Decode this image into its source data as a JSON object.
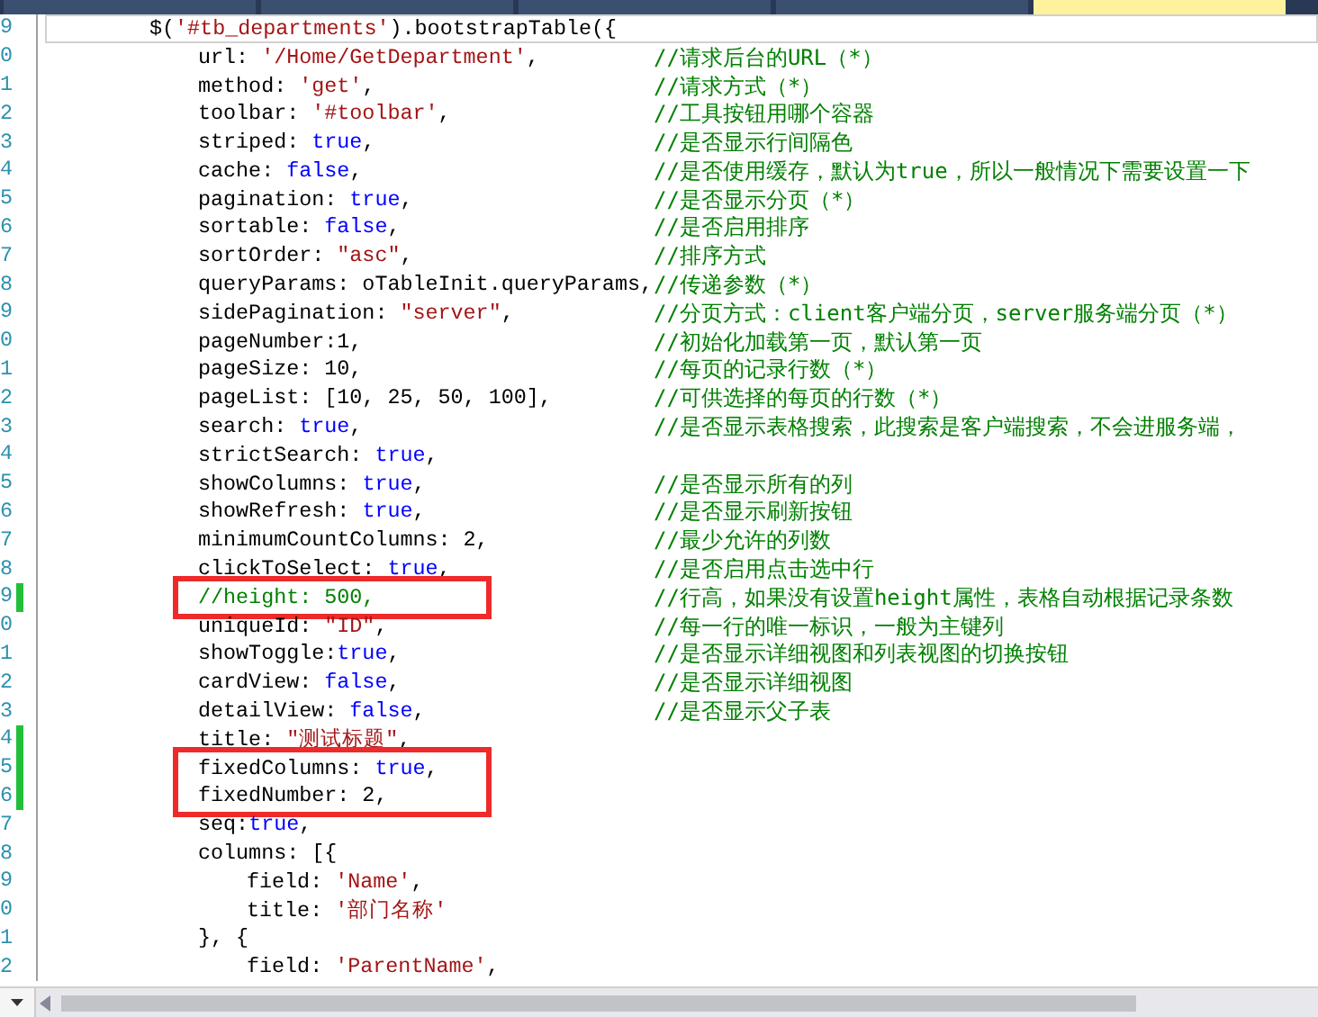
{
  "tabs": [
    {
      "selected": false
    },
    {
      "selected": false
    },
    {
      "selected": false
    },
    {
      "selected": false
    },
    {
      "selected": true
    }
  ],
  "lines": [
    {
      "number": "9",
      "current": true,
      "changed": false,
      "boxed": false,
      "tokens": [
        {
          "kind": "plain",
          "text": "$("
        },
        {
          "kind": "string",
          "text": "'#tb_departments'"
        },
        {
          "kind": "plain",
          "text": ").bootstrapTable({"
        }
      ],
      "children": [
        {
          "number": "0",
          "current": false,
          "changed": false,
          "boxed": false,
          "tokens": [
            {
              "kind": "plain",
              "text": "url: "
            },
            {
              "kind": "string",
              "text": "'/Home/GetDepartment'"
            },
            {
              "kind": "plain",
              "text": ","
            }
          ],
          "comment": "//请求后台的URL（*）"
        },
        {
          "number": "1",
          "current": false,
          "changed": false,
          "boxed": false,
          "tokens": [
            {
              "kind": "plain",
              "text": "method: "
            },
            {
              "kind": "string",
              "text": "'get'"
            },
            {
              "kind": "plain",
              "text": ","
            }
          ],
          "comment": "//请求方式（*）"
        },
        {
          "number": "2",
          "current": false,
          "changed": false,
          "boxed": false,
          "tokens": [
            {
              "kind": "plain",
              "text": "toolbar: "
            },
            {
              "kind": "string",
              "text": "'#toolbar'"
            },
            {
              "kind": "plain",
              "text": ","
            }
          ],
          "comment": "//工具按钮用哪个容器"
        },
        {
          "number": "3",
          "current": false,
          "changed": false,
          "boxed": false,
          "tokens": [
            {
              "kind": "plain",
              "text": "striped: "
            },
            {
              "kind": "keyword",
              "text": "true"
            },
            {
              "kind": "plain",
              "text": ","
            }
          ],
          "comment": "//是否显示行间隔色"
        },
        {
          "number": "4",
          "current": false,
          "changed": false,
          "boxed": false,
          "tokens": [
            {
              "kind": "plain",
              "text": "cache: "
            },
            {
              "kind": "keyword",
              "text": "false"
            },
            {
              "kind": "plain",
              "text": ","
            }
          ],
          "comment": "//是否使用缓存，默认为true，所以一般情况下需要设置一下"
        },
        {
          "number": "5",
          "current": false,
          "changed": false,
          "boxed": false,
          "tokens": [
            {
              "kind": "plain",
              "text": "pagination: "
            },
            {
              "kind": "keyword",
              "text": "true"
            },
            {
              "kind": "plain",
              "text": ","
            }
          ],
          "comment": "//是否显示分页（*）"
        },
        {
          "number": "6",
          "current": false,
          "changed": false,
          "boxed": false,
          "tokens": [
            {
              "kind": "plain",
              "text": "sortable: "
            },
            {
              "kind": "keyword",
              "text": "false"
            },
            {
              "kind": "plain",
              "text": ","
            }
          ],
          "comment": "//是否启用排序"
        },
        {
          "number": "7",
          "current": false,
          "changed": false,
          "boxed": false,
          "tokens": [
            {
              "kind": "plain",
              "text": "sortOrder: "
            },
            {
              "kind": "string",
              "text": "\"asc\""
            },
            {
              "kind": "plain",
              "text": ","
            }
          ],
          "comment": "//排序方式"
        },
        {
          "number": "8",
          "current": false,
          "changed": false,
          "boxed": false,
          "tokens": [
            {
              "kind": "plain",
              "text": "queryParams: oTableInit.queryParams,"
            }
          ],
          "comment": "//传递参数（*）"
        },
        {
          "number": "9",
          "current": false,
          "changed": false,
          "boxed": false,
          "tokens": [
            {
              "kind": "plain",
              "text": "sidePagination: "
            },
            {
              "kind": "string",
              "text": "\"server\""
            },
            {
              "kind": "plain",
              "text": ","
            }
          ],
          "comment": "//分页方式：client客户端分页，server服务端分页（*）"
        },
        {
          "number": "0",
          "current": false,
          "changed": false,
          "boxed": false,
          "tokens": [
            {
              "kind": "plain",
              "text": "pageNumber:1,"
            }
          ],
          "comment": "//初始化加载第一页，默认第一页"
        },
        {
          "number": "1",
          "current": false,
          "changed": false,
          "boxed": false,
          "tokens": [
            {
              "kind": "plain",
              "text": "pageSize: 10,"
            }
          ],
          "comment": "//每页的记录行数（*）"
        },
        {
          "number": "2",
          "current": false,
          "changed": false,
          "boxed": false,
          "tokens": [
            {
              "kind": "plain",
              "text": "pageList: [10, 25, 50, 100],"
            }
          ],
          "comment": "//可供选择的每页的行数（*）"
        },
        {
          "number": "3",
          "current": false,
          "changed": false,
          "boxed": false,
          "tokens": [
            {
              "kind": "plain",
              "text": "search: "
            },
            {
              "kind": "keyword",
              "text": "true"
            },
            {
              "kind": "plain",
              "text": ","
            }
          ],
          "comment": "//是否显示表格搜索，此搜索是客户端搜索，不会进服务端，"
        },
        {
          "number": "4",
          "current": false,
          "changed": false,
          "boxed": false,
          "tokens": [
            {
              "kind": "plain",
              "text": "strictSearch: "
            },
            {
              "kind": "keyword",
              "text": "true"
            },
            {
              "kind": "plain",
              "text": ","
            }
          ]
        },
        {
          "number": "5",
          "current": false,
          "changed": false,
          "boxed": false,
          "tokens": [
            {
              "kind": "plain",
              "text": "showColumns: "
            },
            {
              "kind": "keyword",
              "text": "true"
            },
            {
              "kind": "plain",
              "text": ","
            }
          ],
          "comment": "//是否显示所有的列"
        },
        {
          "number": "6",
          "current": false,
          "changed": false,
          "boxed": false,
          "tokens": [
            {
              "kind": "plain",
              "text": "showRefresh: "
            },
            {
              "kind": "keyword",
              "text": "true"
            },
            {
              "kind": "plain",
              "text": ","
            }
          ],
          "comment": "//是否显示刷新按钮"
        },
        {
          "number": "7",
          "current": false,
          "changed": false,
          "boxed": false,
          "tokens": [
            {
              "kind": "plain",
              "text": "minimumCountColumns: 2,"
            }
          ],
          "comment": "//最少允许的列数"
        },
        {
          "number": "8",
          "current": false,
          "changed": false,
          "boxed": false,
          "tokens": [
            {
              "kind": "plain",
              "text": "clickToSelect: "
            },
            {
              "kind": "keyword",
              "text": "true"
            },
            {
              "kind": "plain",
              "text": ","
            }
          ],
          "comment": "//是否启用点击选中行"
        },
        {
          "number": "9",
          "current": false,
          "changed": true,
          "boxed": true,
          "tokens": [
            {
              "kind": "comment",
              "text": "//height: 500,"
            }
          ],
          "comment": "//行高，如果没有设置height属性，表格自动根据记录条数"
        },
        {
          "number": "0",
          "current": false,
          "changed": false,
          "boxed": false,
          "tokens": [
            {
              "kind": "plain",
              "text": "uniqueId: "
            },
            {
              "kind": "string",
              "text": "\"ID\""
            },
            {
              "kind": "plain",
              "text": ","
            }
          ],
          "comment": "//每一行的唯一标识，一般为主键列"
        },
        {
          "number": "1",
          "current": false,
          "changed": false,
          "boxed": false,
          "tokens": [
            {
              "kind": "plain",
              "text": "showToggle:"
            },
            {
              "kind": "keyword",
              "text": "true"
            },
            {
              "kind": "plain",
              "text": ","
            }
          ],
          "comment": "//是否显示详细视图和列表视图的切换按钮"
        },
        {
          "number": "2",
          "current": false,
          "changed": false,
          "boxed": false,
          "tokens": [
            {
              "kind": "plain",
              "text": "cardView: "
            },
            {
              "kind": "keyword",
              "text": "false"
            },
            {
              "kind": "plain",
              "text": ","
            }
          ],
          "comment": "//是否显示详细视图"
        },
        {
          "number": "3",
          "current": false,
          "changed": false,
          "boxed": false,
          "tokens": [
            {
              "kind": "plain",
              "text": "detailView: "
            },
            {
              "kind": "keyword",
              "text": "false"
            },
            {
              "kind": "plain",
              "text": ","
            }
          ],
          "comment": "//是否显示父子表"
        },
        {
          "number": "4",
          "current": false,
          "changed": true,
          "boxed": false,
          "tokens": [
            {
              "kind": "plain",
              "text": "title: "
            },
            {
              "kind": "string",
              "text": "\"测试标题\""
            },
            {
              "kind": "plain",
              "text": ","
            }
          ]
        },
        {
          "number": "5",
          "current": false,
          "changed": true,
          "boxed": true,
          "tokens": [
            {
              "kind": "plain",
              "text": "fixedColumns: "
            },
            {
              "kind": "keyword",
              "text": "true"
            },
            {
              "kind": "plain",
              "text": ","
            }
          ]
        },
        {
          "number": "6",
          "current": false,
          "changed": true,
          "boxed": true,
          "tokens": [
            {
              "kind": "plain",
              "text": "fixedNumber: 2,"
            }
          ]
        },
        {
          "number": "7",
          "current": false,
          "changed": false,
          "boxed": false,
          "tokens": [
            {
              "kind": "plain",
              "text": "seq:"
            },
            {
              "kind": "keyword",
              "text": "true"
            },
            {
              "kind": "plain",
              "text": ","
            }
          ]
        },
        {
          "number": "8",
          "current": false,
          "changed": false,
          "boxed": false,
          "tokens": [
            {
              "kind": "plain",
              "text": "columns: [{"
            }
          ],
          "children": [
            {
              "number": "9",
              "current": false,
              "changed": false,
              "boxed": false,
              "tokens": [
                {
                  "kind": "plain",
                  "text": "field: "
                },
                {
                  "kind": "string",
                  "text": "'Name'"
                },
                {
                  "kind": "plain",
                  "text": ","
                }
              ]
            },
            {
              "number": "0",
              "current": false,
              "changed": false,
              "boxed": false,
              "tokens": [
                {
                  "kind": "plain",
                  "text": "title: "
                },
                {
                  "kind": "string",
                  "text": "'部门名称'"
                }
              ]
            }
          ]
        },
        {
          "number": "1",
          "current": false,
          "changed": false,
          "boxed": false,
          "tokens": [
            {
              "kind": "plain",
              "text": "}, {"
            }
          ],
          "children": [
            {
              "number": "2",
              "current": false,
              "changed": false,
              "boxed": false,
              "tokens": [
                {
                  "kind": "plain",
                  "text": "field: "
                },
                {
                  "kind": "string",
                  "text": "'ParentName'"
                },
                {
                  "kind": "plain",
                  "text": ","
                }
              ]
            }
          ]
        }
      ]
    }
  ]
}
